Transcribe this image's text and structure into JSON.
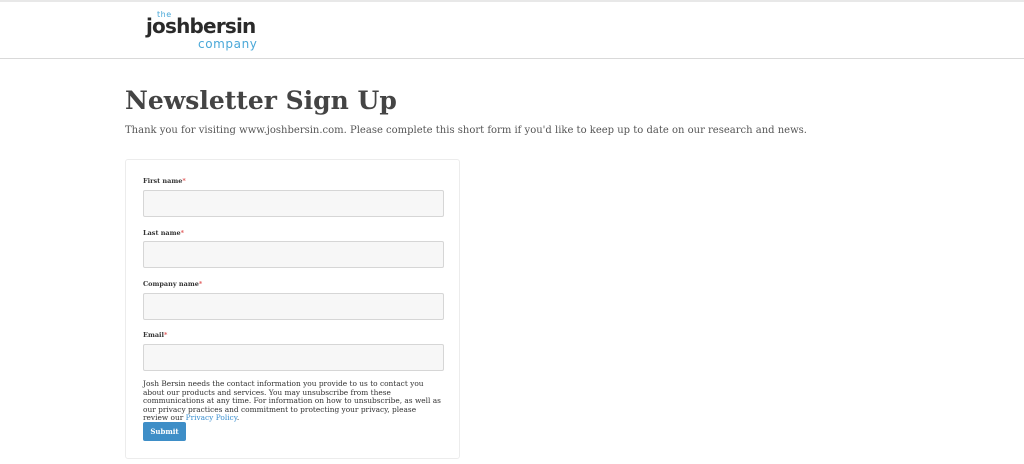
{
  "header": {
    "logo": {
      "small": "the",
      "main": "joshbersin",
      "sub": "company"
    }
  },
  "page": {
    "title": "Newsletter Sign Up",
    "intro": "Thank you for visiting www.joshbersin.com. Please complete this short form if you'd like to keep up to date on our research and news."
  },
  "form": {
    "fields": [
      {
        "label": "First name",
        "required_mark": "*",
        "value": "",
        "placeholder": ""
      },
      {
        "label": "Last name",
        "required_mark": "*",
        "value": "",
        "placeholder": ""
      },
      {
        "label": "Company name",
        "required_mark": "*",
        "value": "",
        "placeholder": ""
      },
      {
        "label": "Email",
        "required_mark": "*",
        "value": "",
        "placeholder": ""
      }
    ],
    "disclaimer_text": "Josh Bersin needs the contact information you provide to us to contact you about our products and services. You may unsubscribe from these communications at any time. For information on how to unsubscribe, as well as our privacy practices and commitment to protecting your privacy, please review our ",
    "privacy_link": "Privacy Policy",
    "disclaimer_end": ".",
    "submit_label": "Submit"
  },
  "colors": {
    "accent": "#3e8ec7",
    "logo_blue": "#4aa8d8",
    "required": "#e05555"
  }
}
